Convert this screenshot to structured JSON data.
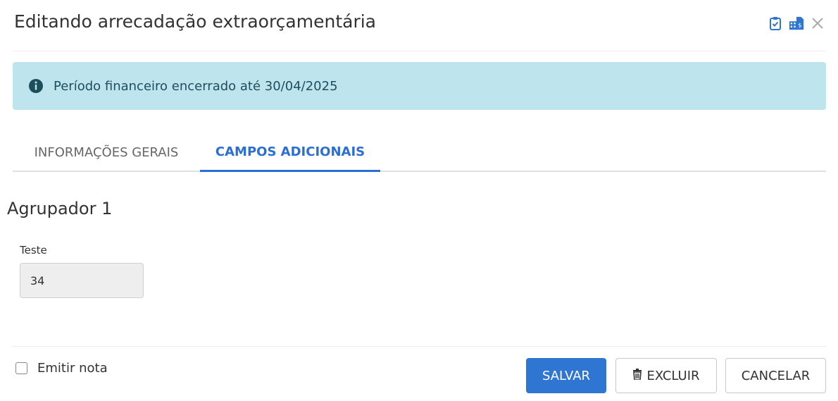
{
  "dialog": {
    "title": "Editando arrecadação extraorçamentária",
    "header_icons": [
      "clipboard-check-icon",
      "building-document-icon",
      "close-icon"
    ]
  },
  "alert": {
    "icon": "info-icon",
    "text": "Período financeiro encerrado até 30/04/2025",
    "background": "#bee5ee"
  },
  "tabs": [
    {
      "label": "INFORMAÇÕES GERAIS",
      "active": false
    },
    {
      "label": "CAMPOS ADICIONAIS",
      "active": true
    }
  ],
  "group": {
    "title": "Agrupador 1",
    "fields": [
      {
        "label": "Teste",
        "value": "34"
      }
    ]
  },
  "footer": {
    "checkbox_label": "Emitir nota",
    "checkbox_checked": false,
    "save_label": "SALVAR",
    "delete_label": "EXCLUIR",
    "cancel_label": "CANCELAR"
  },
  "colors": {
    "accent": "#2f76d2",
    "tab_active": "#2a6fd6"
  }
}
